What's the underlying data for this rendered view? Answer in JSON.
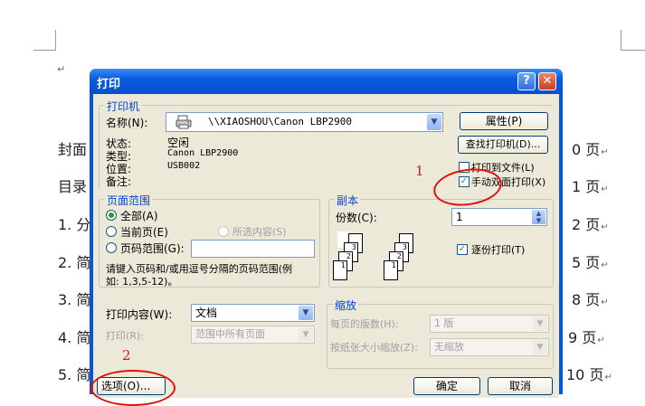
{
  "document": {
    "lines": [
      {
        "label": "封面",
        "page": "0 页"
      },
      {
        "label": "目录",
        "page": "1 页"
      },
      {
        "label": "1. 分",
        "page": "2 页"
      },
      {
        "label": "2. 简",
        "page": "5 页"
      },
      {
        "label": "3. 简",
        "page": "8 页"
      },
      {
        "label": "4. 简",
        "page": "9 页"
      },
      {
        "label": "5. 简",
        "page": "10 页"
      }
    ],
    "para_mark": "↵"
  },
  "dialog": {
    "title": "打印",
    "help_glyph": "?",
    "close_glyph": "✕",
    "printer": {
      "group_label": "打印机",
      "name_label": "名称(N):",
      "name_value": "\\\\XIAOSHOU\\Canon LBP2900",
      "status_label": "状态:",
      "status_value": "空闲",
      "type_label": "类型:",
      "type_value": "Canon LBP2900",
      "where_label": "位置:",
      "where_value": "USB002",
      "comment_label": "备注:",
      "properties_button": "属性(P)",
      "find_printer_button": "查找打印机(D)...",
      "print_to_file": "打印到文件(L)",
      "manual_duplex": "手动双面打印(X)"
    },
    "page_range": {
      "group_label": "页面范围",
      "all": "全部(A)",
      "current": "当前页(E)",
      "selection": "所选内容(S)",
      "pages": "页码范围(G):",
      "pages_value": "",
      "hint_line1": "请键入页码和/或用逗号分隔的页码范围(例",
      "hint_line2": "如: 1,3,5-12)。"
    },
    "copies": {
      "group_label": "副本",
      "count_label": "份数(C):",
      "count_value": "1",
      "collate": "逐份打印(T)"
    },
    "print_what_label": "打印内容(W):",
    "print_what_value": "文档",
    "print_label": "打印(R):",
    "print_value": "范围中所有页面",
    "zoom": {
      "group_label": "缩放",
      "pages_per_sheet_label": "每页的版数(H):",
      "pages_per_sheet_value": "1 版",
      "scale_label": "按纸张大小缩放(Z):",
      "scale_value": "无缩放"
    },
    "options_button": "选项(O)...",
    "ok_button": "确定",
    "cancel_button": "取消"
  },
  "annotations": {
    "one": "1",
    "two": "2",
    "color": "#e01010"
  }
}
